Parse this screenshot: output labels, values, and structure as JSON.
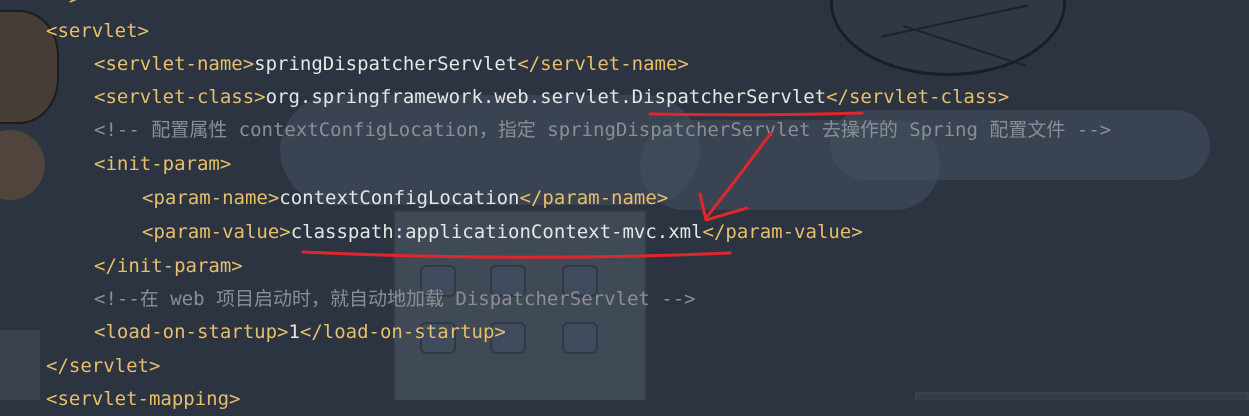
{
  "editor": {
    "lines": [
      {
        "parts": [
          {
            "cls": "tag",
            "text": "</"
          },
          {
            "cls": "tag",
            "text": ""
          }
        ],
        "hidden": true
      },
      {
        "parts": [
          {
            "cls": "tag",
            "text": "<servlet>"
          }
        ]
      },
      {
        "parts": [
          {
            "cls": "tag",
            "text": "<servlet-name>"
          },
          {
            "cls": "txt",
            "text": "springDispatcherServlet"
          },
          {
            "cls": "tag",
            "text": "</servlet-name>"
          }
        ]
      },
      {
        "parts": [
          {
            "cls": "tag",
            "text": "<servlet-class>"
          },
          {
            "cls": "txt",
            "text": "org.springframework.web.servlet.DispatcherServlet"
          },
          {
            "cls": "tag",
            "text": "</servlet-class>"
          }
        ]
      },
      {
        "parts": [
          {
            "cls": "cmt",
            "text": "<!-- 配置属性 contextConfigLocation，指定 springDispatcherServlet 去操作的 Spring 配置文件 -->"
          }
        ]
      },
      {
        "parts": [
          {
            "cls": "tag",
            "text": "<init-param>"
          }
        ]
      },
      {
        "parts": [
          {
            "cls": "tag",
            "text": "<param-name>"
          },
          {
            "cls": "txt",
            "text": "contextConfigLocation"
          },
          {
            "cls": "tag",
            "text": "</param-name>"
          }
        ]
      },
      {
        "parts": [
          {
            "cls": "tag",
            "text": "<param-value>"
          },
          {
            "cls": "txt",
            "text": "classpath:applicationContext-mvc.xml"
          },
          {
            "cls": "tag",
            "text": "</param-value>"
          }
        ]
      },
      {
        "parts": [
          {
            "cls": "tag",
            "text": "</init-param>"
          }
        ]
      },
      {
        "parts": [
          {
            "cls": "cmt",
            "text": "<!--在 web 项目启动时，就自动地加载 DispatcherServlet -->"
          }
        ]
      },
      {
        "parts": [
          {
            "cls": "tag",
            "text": "<load-on-startup>"
          },
          {
            "cls": "txt",
            "text": "1"
          },
          {
            "cls": "tag",
            "text": "</load-on-startup>"
          }
        ]
      },
      {
        "parts": [
          {
            "cls": "tag",
            "text": "</servlet>"
          }
        ]
      },
      {
        "parts": [
          {
            "cls": "tag",
            "text": "<servlet-mapping>"
          }
        ]
      }
    ]
  },
  "annotation_color": "#e0262b"
}
